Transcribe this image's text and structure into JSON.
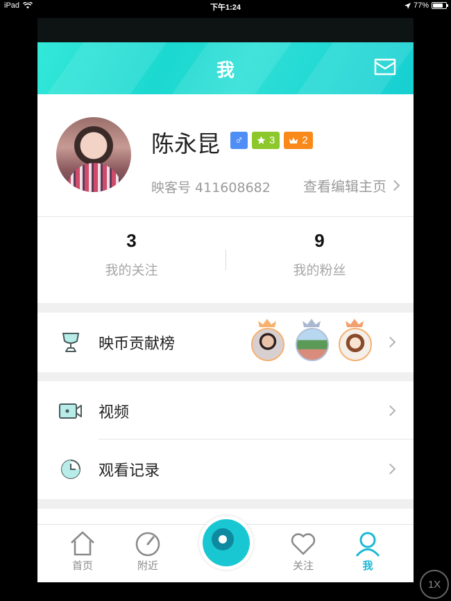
{
  "status_bar": {
    "device": "iPad",
    "time": "下午1:24",
    "battery_text": "77%",
    "battery_level": 0.77
  },
  "navbar": {
    "title": "我",
    "icon": "mail-icon"
  },
  "profile": {
    "name": "陈永昆",
    "gender_symbol": "♂",
    "star_level": "3",
    "crown_level": "2",
    "user_id": "映客号 411608682",
    "edit_link": "查看编辑主页"
  },
  "stats": [
    {
      "value": "3",
      "label": "我的关注"
    },
    {
      "value": "9",
      "label": "我的粉丝"
    }
  ],
  "menu": {
    "contribution": {
      "label": "映币贡献榜",
      "icon": "trophy-icon"
    },
    "video": {
      "label": "视频",
      "icon": "video-camera-icon"
    },
    "history": {
      "label": "观看记录",
      "icon": "clock-icon"
    }
  },
  "tabbar": {
    "home": "首页",
    "nearby": "附近",
    "follow": "关注",
    "me": "我"
  },
  "colors": {
    "accent": "#19c7d3",
    "badge_gender": "#4f8ef7",
    "badge_star": "#8cc82b",
    "badge_crown": "#f9891a"
  },
  "zoom_badge": "1X"
}
